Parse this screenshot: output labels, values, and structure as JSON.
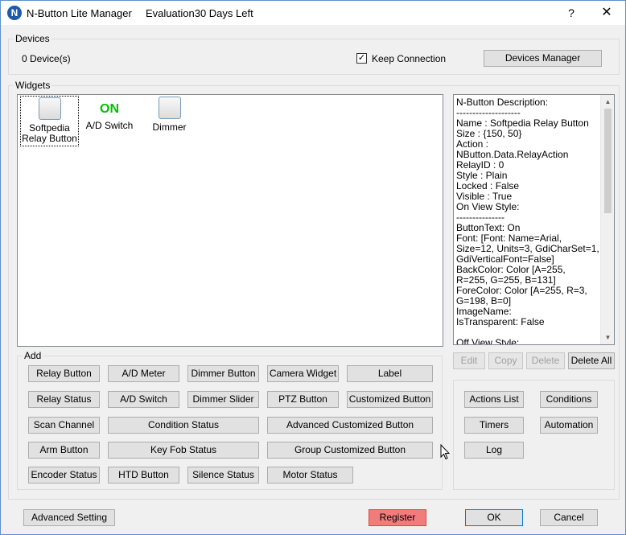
{
  "window": {
    "title": "N-Button Lite Manager",
    "evaluation": "Evaluation30 Days Left",
    "icon_letter": "N",
    "help_glyph": "?",
    "close_glyph": "✕"
  },
  "devices": {
    "legend": "Devices",
    "count_text": "0 Device(s)",
    "keep_connection_label": "Keep Connection",
    "keep_connection_checked": true,
    "check_glyph": "✓",
    "manager_button": "Devices Manager"
  },
  "widgets": {
    "legend": "Widgets",
    "items": [
      {
        "label": "Softpedia Relay Button",
        "selected": true,
        "icon": "button-square-icon"
      },
      {
        "label": "A/D Switch",
        "on_text": "ON",
        "on_color": "#00c000"
      },
      {
        "label": "Dimmer",
        "icon": "button-square-icon"
      }
    ]
  },
  "description": {
    "text": "N-Button Description:\n--------------------\nName : Softpedia Relay Button\nSize : {150, 50}\nAction : NButton.Data.RelayAction\nRelayID : 0\nStyle : Plain\nLocked : False\nVisible : True\nOn View Style:\n---------------\nButtonText: On\nFont: [Font: Name=Arial, Size=12, Units=3, GdiCharSet=1, GdiVerticalFont=False]\nBackColor: Color [A=255, R=255, G=255, B=131]\nForeColor: Color [A=255, R=3, G=198, B=0]\nImageName:\nIsTransparent: False\n\nOff View Style:",
    "scroll_up": "▲",
    "scroll_down": "▼",
    "actions": [
      "Edit",
      "Copy",
      "Delete",
      "Delete All"
    ]
  },
  "add": {
    "legend": "Add",
    "row1": [
      "Relay Button",
      "A/D Meter",
      "Dimmer Button",
      "Camera Widget",
      "Label"
    ],
    "row2": [
      "Relay Status",
      "A/D Switch",
      "Dimmer Slider",
      "PTZ Button",
      "Customized Button"
    ],
    "row3": [
      "Scan Channel",
      "Condition Status",
      "Advanced Customized Button"
    ],
    "row4": [
      "Arm Button",
      "Key Fob Status",
      "Group Customized Button"
    ],
    "row5": [
      "Encoder Status",
      "HTD Button",
      "Silence Status",
      "Motor Status"
    ]
  },
  "right_panel": {
    "buttons": [
      "Actions List",
      "Conditions",
      "Timers",
      "Automation",
      "Log"
    ]
  },
  "footer": {
    "advanced": "Advanced Setting",
    "register": "Register",
    "ok": "OK",
    "cancel": "Cancel"
  },
  "colors": {
    "register_bg": "#f17c7c",
    "accent": "#0078d7"
  }
}
